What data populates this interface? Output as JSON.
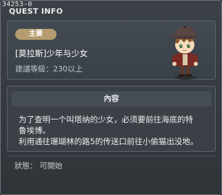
{
  "window": {
    "id_label": "34253-0",
    "title": "QUEST INFO"
  },
  "quest": {
    "type_badge": "主要",
    "title": "[莫拉斯]少年与少女",
    "level_requirement": "建議等級：230以上",
    "portrait": "npc-boy-portrait"
  },
  "content": {
    "header": "內容",
    "lines": [
      "为了查明一个叫塔纳的少女，必须要前往海底的特",
      "鲁埃博。",
      "利用通往珊瑚林的路5的传送口前往小偷猫出没地。"
    ]
  },
  "status": "狀態： 可開始",
  "colors": {
    "badge": "#b59b6f",
    "panel": "#3b4046",
    "window_bg": "#33383d"
  }
}
